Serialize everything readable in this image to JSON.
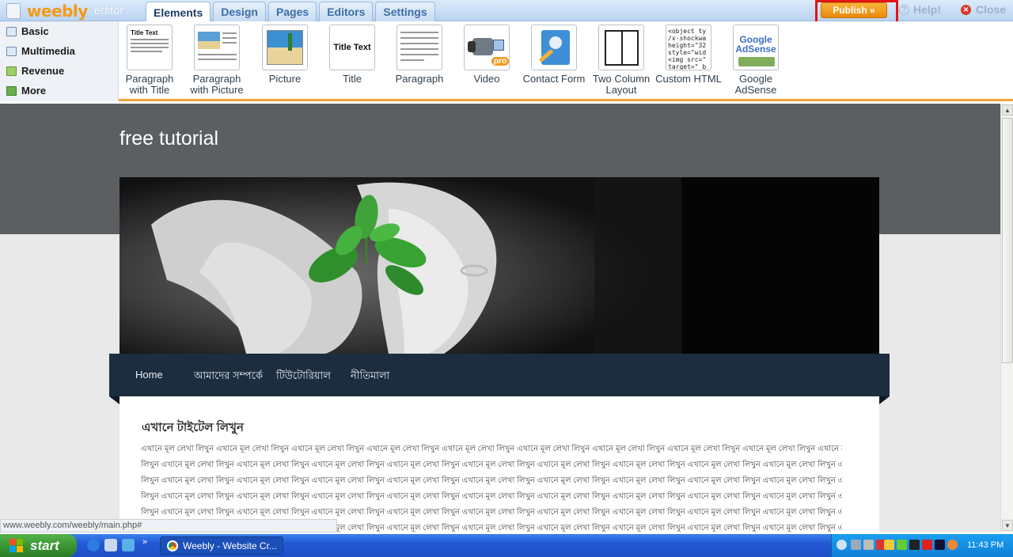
{
  "app": {
    "logo": "weebly",
    "logo_suffix": "editor"
  },
  "tabs": [
    "Elements",
    "Design",
    "Pages",
    "Editors",
    "Settings"
  ],
  "active_tab": "Elements",
  "toolbar": {
    "publish": "Publish »",
    "help": "Help!",
    "close": "Close"
  },
  "sidebar": {
    "items": [
      {
        "label": "Basic",
        "icon": "page-icon"
      },
      {
        "label": "Multimedia",
        "icon": "film-icon"
      },
      {
        "label": "Revenue",
        "icon": "money-icon"
      },
      {
        "label": "More",
        "icon": "arrow-icon"
      }
    ]
  },
  "elements": [
    {
      "label": "Paragraph with Title",
      "thumb_text": "Title Text"
    },
    {
      "label": "Paragraph with Picture"
    },
    {
      "label": "Picture"
    },
    {
      "label": "Title",
      "thumb_text": "Title Text"
    },
    {
      "label": "Paragraph"
    },
    {
      "label": "Video"
    },
    {
      "label": "Contact Form"
    },
    {
      "label": "Two Column Layout"
    },
    {
      "label": "Custom HTML",
      "thumb_text": "<object ty /x-shockwa height=\"32 style=\"wid <img src=\" target=\"_b"
    },
    {
      "label": "Google AdSense",
      "thumb_text": "Google AdSense"
    }
  ],
  "site": {
    "title": "free tutorial",
    "nav": [
      "Home",
      "আমাদের সম্পর্কে",
      "টিউটোরিয়াল",
      "নীতিমালা"
    ],
    "content_title": "এখানে টাইটেল লিখুন",
    "content_lines": [
      "এখানে মূল লেখা লিখুন এখানে মূল লেখা লিখুন এখানে মূল লেখা লিখুন এখানে মূল লেখা লিখুন এখানে মূল লেখা লিখুন এখানে মূল লেখা লিখুন এখানে মূল লেখা লিখুন এখানে মূল লেখা লিখুন এখানে মূল লেখা লিখুন এখানে মূল লেখা",
      "লিখুন এখানে মূল লেখা লিখুন এখানে মূল লেখা লিখুন এখানে মূল লেখা লিখুন এখানে মূল লেখা লিখুন এখানে মূল লেখা লিখুন এখানে মূল লেখা লিখুন এখানে মূল লেখা লিখুন এখানে মূল লেখা লিখুন এখানে মূল লেখা লিখুন এখানে মূল লেখা",
      "লিখুন এখানে মূল লেখা লিখুন এখানে মূল লেখা লিখুন এখানে মূল লেখা লিখুন এখানে মূল লেখা লিখুন এখানে মূল লেখা লিখুন এখানে মূল লেখা লিখুন এখানে মূল লেখা লিখুন এখানে মূল লেখা লিখুন এখানে মূল লেখা লিখুন এখানে মূল লেখা",
      "লিখুন এখানে মূল লেখা লিখুন এখানে মূল লেখা লিখুন এখানে মূল লেখা লিখুন এখানে মূল লেখা লিখুন এখানে মূল লেখা লিখুন এখানে মূল লেখা লিখুন এখানে মূল লেখা লিখুন এখানে মূল লেখা লিখুন এখানে মূল লেখা লিখুন এখানে মূল লেখা",
      "লিখুন এখানে মূল লেখা লিখুন এখানে মূল লেখা লিখুন এখানে মূল লেখা লিখুন এখানে মূল লেখা লিখুন এখানে মূল লেখা লিখুন এখানে মূল লেখা লিখুন এখানে মূল লেখা লিখুন এখানে মূল লেখা লিখুন এখানে মূল লেখা লিখুন এখানে মূল লেখা",
      "লিখুন এখানে মূল লেখা লিখুন এখানে মূল লেখা লিখুন এখানে মূল লেখা লিখুন এখানে মূল লেখা লিখুন এখানে মূল লেখা লিখুন এখানে মূল লেখা লিখুন এখানে মূল লেখা লিখুন এখানে মূল লেখা লিখুন এখানে মূল লেখা লিখুন এখানে মূল লেখা"
    ]
  },
  "status_url": "www.weebly.com/weebly/main.php#",
  "taskbar": {
    "start": "start",
    "window": "Weebly - Website Cr...",
    "clock": "11:43 PM"
  },
  "colors": {
    "accent": "#f39a16",
    "nav_bg": "#1c2d3f",
    "highlight": "#e31515"
  }
}
